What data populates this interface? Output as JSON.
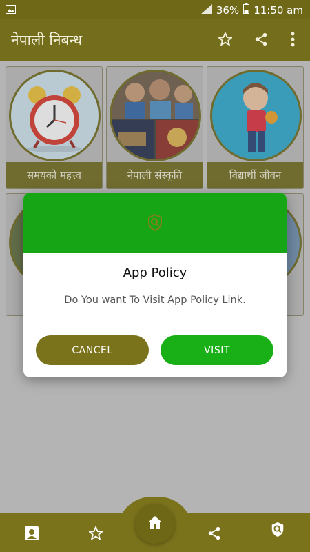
{
  "status": {
    "battery_pct": "36%",
    "time": "11:50 am"
  },
  "app": {
    "title": "नेपाली निबन्ध"
  },
  "grid": {
    "items": [
      {
        "label": "समयको महत्त्व",
        "icon": "alarm-clock-image"
      },
      {
        "label": "नेपाली संस्कृति",
        "icon": "nepali-culture-collage-image"
      },
      {
        "label": "विद्यार्थी जीवन",
        "icon": "student-cartoon-image"
      }
    ]
  },
  "dialog": {
    "title": "App Policy",
    "message": "Do You want To Visit App Policy Link.",
    "cancel_label": "CANCEL",
    "visit_label": "VISIT",
    "icon": "shield-icon"
  },
  "bottom_nav": {
    "items": [
      "contact-icon",
      "star-icon",
      "home-icon",
      "share-icon",
      "policy-shield-icon"
    ]
  },
  "colors": {
    "primary": "#736d1c",
    "accent_green": "#16a515",
    "label_bg": "#6e6817"
  }
}
